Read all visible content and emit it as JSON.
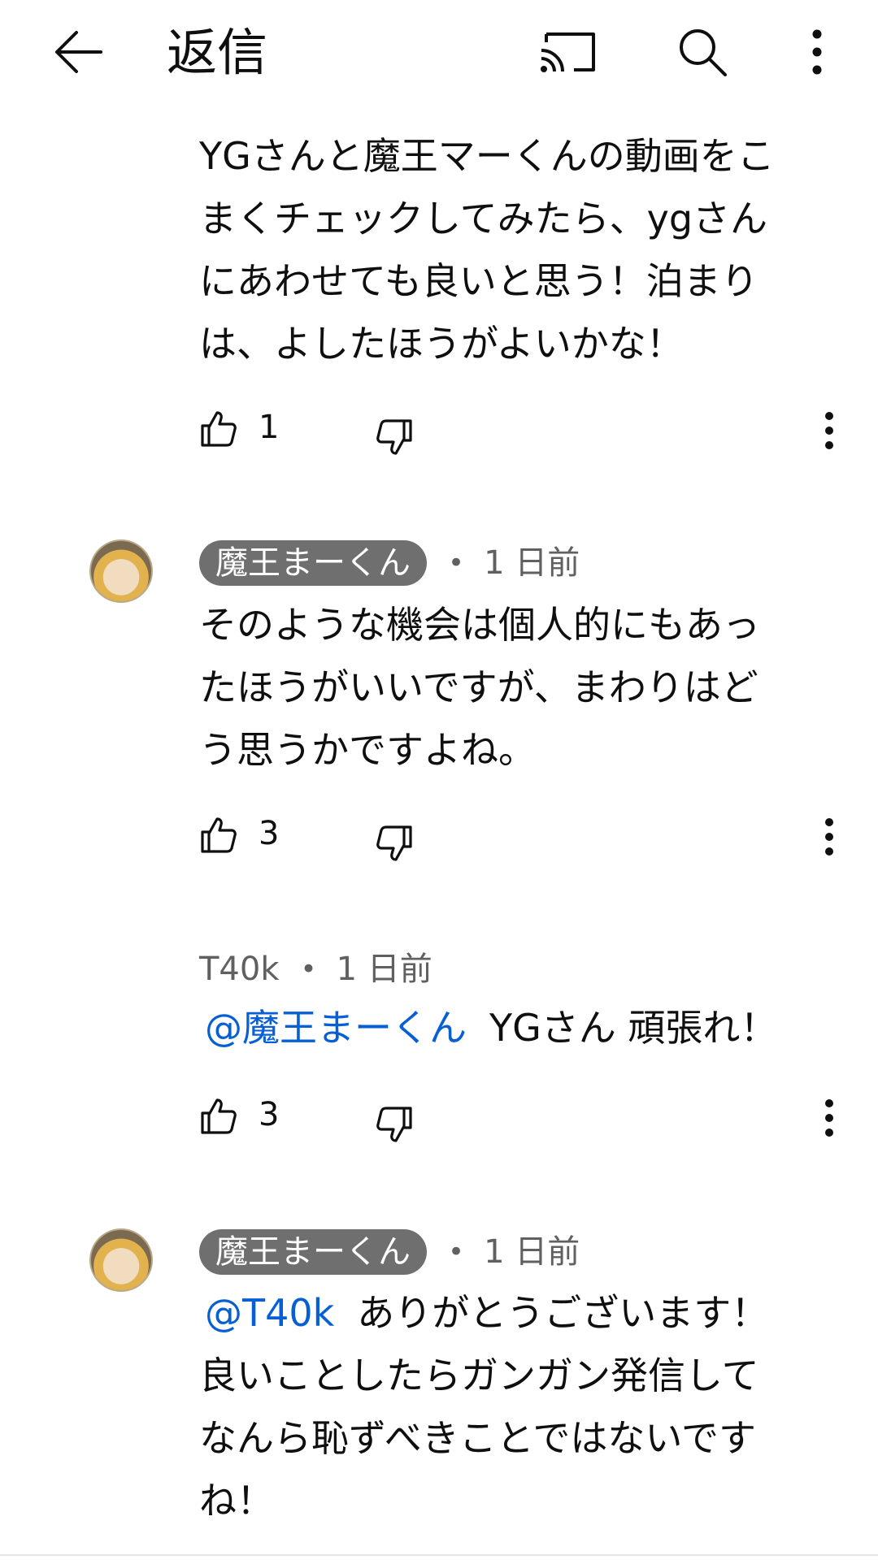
{
  "header": {
    "title": "返信",
    "back_icon": "arrow-back-icon",
    "cast_icon": "cast-icon",
    "search_icon": "search-icon",
    "more_icon": "more-vert-icon"
  },
  "comments": [
    {
      "lines": [
        "YGさんと魔王マーくんの動画をこ",
        "まくチェックしてみたら、ygさん",
        "にあわせても良いと思う！泊まり",
        "は、よしたほうがよいかな！"
      ],
      "likes": "1"
    },
    {
      "author": "魔王まーくん",
      "separator": "•",
      "time": "1 日前",
      "lines": [
        "そのような機会は個人的にもあっ",
        "たほうがいいですが、まわりはど",
        "う思うかですよね。"
      ],
      "likes": "3"
    },
    {
      "author": "T40k",
      "separator": "•",
      "time": "1 日前",
      "mention": "@魔王まーくん",
      "text": "YGさん 頑張れ！",
      "likes": "3"
    },
    {
      "author": "魔王まーくん",
      "separator": "•",
      "time": "1 日前",
      "mention": "@T40k",
      "first_line": "ありがとうございます！",
      "lines": [
        "良いことしたらガンガン発信して",
        "なんら恥ずべきことではないです",
        "ね！"
      ]
    }
  ],
  "colors": {
    "accent_link": "#065fd4",
    "chip_background": "#6f6f6f",
    "secondary_text": "#606060",
    "text": "#0f0f0f"
  }
}
